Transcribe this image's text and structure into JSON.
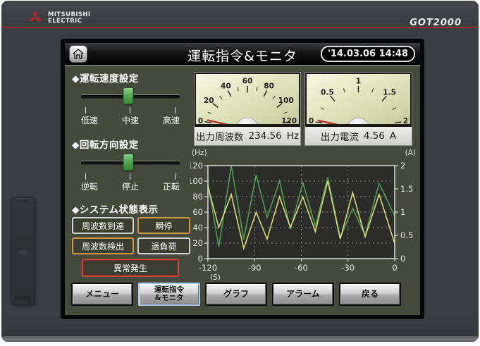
{
  "device": {
    "brand_line1": "MITSUBISHI",
    "brand_line2": "ELECTRIC",
    "model": "GOT2000",
    "accent_red": "#a5282a"
  },
  "header": {
    "title": "運転指令&モニタ",
    "datetime": "'14.03.06 14:48"
  },
  "speed_section": {
    "title": "◆運転速度設定",
    "labels": [
      "低速",
      "中速",
      "高速"
    ],
    "selected": "中速",
    "handle_position_pct": 48
  },
  "direction_section": {
    "title": "◆回転方向設定",
    "labels": [
      "逆転",
      "停止",
      "正転"
    ],
    "selected": "停止",
    "handle_position_pct": 48
  },
  "status_section": {
    "title": "◆システム状態表示",
    "indicators": [
      {
        "label": "周波数到達",
        "border": "#d2d2d2",
        "state": "normal"
      },
      {
        "label": "瞬停",
        "border": "#cf9a3d",
        "state": "highlighted"
      },
      {
        "label": "周波数検出",
        "border": "#cf9a3d",
        "state": "highlighted"
      },
      {
        "label": "過負荷",
        "border": "#d2d2d2",
        "state": "normal"
      },
      {
        "label": "異常発生",
        "border": "#c8453a",
        "state": "alarm"
      }
    ]
  },
  "gauges": [
    {
      "label": "出力周波数",
      "value": "234.56",
      "unit": "Hz",
      "min": 0,
      "max": 120,
      "major_ticks": [
        0,
        20,
        40,
        60,
        80,
        100,
        120
      ],
      "needle_value": 2,
      "needle_color": "#c03028"
    },
    {
      "label": "出力電流",
      "value": "4.56",
      "unit": "A",
      "min": 0,
      "max": 2,
      "major_ticks": [
        0,
        0.5,
        1,
        1.5,
        2
      ],
      "needle_value": 0.03,
      "needle_color": "#c03028"
    }
  ],
  "chart_data": {
    "type": "line",
    "x_axis_label": "(S)",
    "y_left_label": "(Hz)",
    "y_right_label": "(A)",
    "x_range": [
      -120,
      0
    ],
    "y_left_range": [
      0,
      120
    ],
    "y_right_range": [
      0,
      2
    ],
    "x_ticks": [
      -120,
      -90,
      -60,
      -30,
      0
    ],
    "y_left_ticks": [
      0,
      20,
      40,
      60,
      80,
      100,
      120
    ],
    "y_right_ticks": [
      0,
      0.5,
      1,
      1.5,
      2
    ],
    "grid": "dotted",
    "legend": "none",
    "series": [
      {
        "name": "出力周波数",
        "axis": "left",
        "color": "#4f9e4f",
        "x": [
          -120,
          -113,
          -105,
          -97,
          -89,
          -82,
          -74,
          -67,
          -59,
          -51,
          -43,
          -35,
          -27,
          -19,
          -10,
          0
        ],
        "y": [
          97,
          15,
          120,
          25,
          108,
          53,
          100,
          38,
          98,
          42,
          105,
          27,
          65,
          30,
          97,
          55
        ]
      },
      {
        "name": "出力電流",
        "axis": "right",
        "color": "#d8d878",
        "x": [
          -120,
          -113,
          -105,
          -97,
          -89,
          -82,
          -74,
          -67,
          -59,
          -51,
          -43,
          -35,
          -27,
          -19,
          -10,
          0
        ],
        "y": [
          1.55,
          0.67,
          1.38,
          0.22,
          1.0,
          0.42,
          1.33,
          0.67,
          1.33,
          0.58,
          1.67,
          0.42,
          1.42,
          0.47,
          1.38,
          0.32
        ]
      }
    ]
  },
  "nav": {
    "active_color": "#a9c9ec",
    "buttons": [
      {
        "label": "メニュー",
        "active": false
      },
      {
        "label": "運転指令\n&モニタ",
        "active": true
      },
      {
        "label": "グラフ",
        "active": false
      },
      {
        "label": "アラーム",
        "active": false
      },
      {
        "label": "戻る",
        "active": false
      }
    ]
  }
}
